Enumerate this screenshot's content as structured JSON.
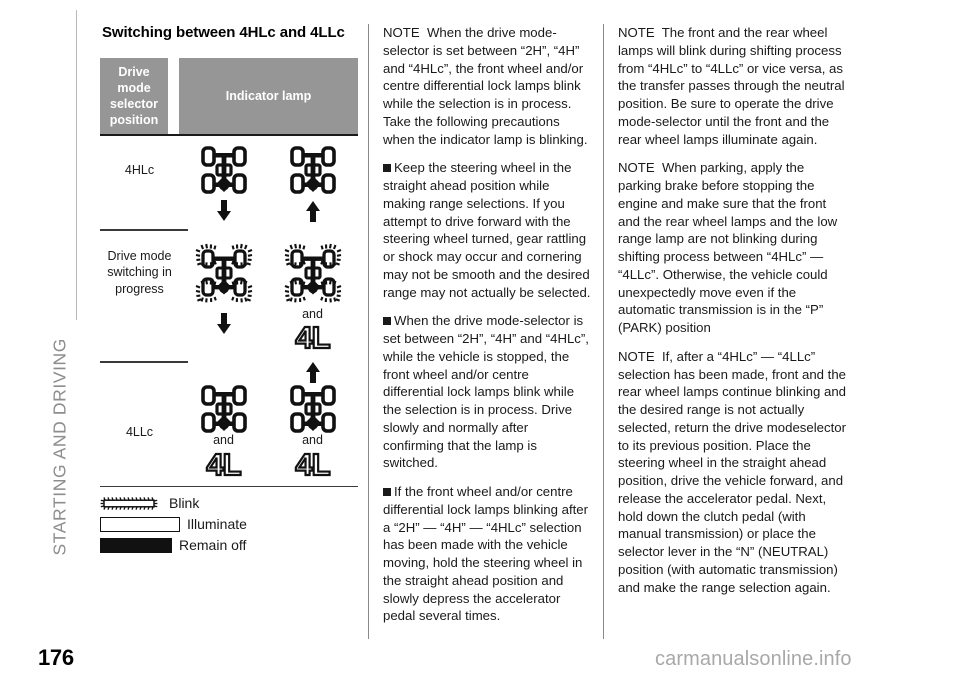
{
  "chapter": {
    "label": "STARTING AND DRIVING"
  },
  "page": {
    "number": "176"
  },
  "watermark": {
    "text": "carmanualsonline.info"
  },
  "section": {
    "title": "Switching between 4HLc and 4LLc"
  },
  "table": {
    "headers": {
      "col_selector": "Drive mode selector position",
      "col_indicator": "Indicator lamp"
    },
    "rows": [
      {
        "label": "4HLc",
        "left": {
          "icon": "four-wheel-drive-lamp",
          "state": "illuminate",
          "and": "",
          "badge": ""
        },
        "right": {
          "icon": "four-wheel-drive-lamp",
          "state": "illuminate",
          "and": "",
          "badge": ""
        },
        "left_arrow": "down",
        "right_arrow": "up"
      },
      {
        "label": "Drive mode switching in progress",
        "left": {
          "icon": "four-wheel-drive-lamp-blinking",
          "state": "blink",
          "and": "",
          "badge": ""
        },
        "right": {
          "icon": "four-wheel-drive-lamp-blinking",
          "state": "blink",
          "and": "and",
          "badge": "4L"
        },
        "left_arrow": "down",
        "right_arrow": "up"
      },
      {
        "label": "4LLc",
        "left": {
          "icon": "four-wheel-drive-lamp",
          "state": "illuminate",
          "and": "and",
          "badge": "4L"
        },
        "right": {
          "icon": "four-wheel-drive-lamp",
          "state": "illuminate",
          "and": "and",
          "badge": "4L"
        },
        "left_arrow": "",
        "right_arrow": ""
      }
    ]
  },
  "legend": {
    "items": [
      {
        "swatch": "blink-swatch",
        "label": "Blink"
      },
      {
        "swatch": "illuminate-swatch",
        "label": "Illuminate"
      },
      {
        "swatch": "remain-off-swatch",
        "label": "Remain off"
      }
    ]
  },
  "middle_column": {
    "note1_lead": "NOTE",
    "note1": "When the drive mode-selector is set between “2H”, “4H” and “4HLc”, the front wheel and/or centre differential lock lamps blink while the selection is in process. Take the following precautions when the indicator lamp is blinking.",
    "bullet1": "Keep the steering wheel in the straight ahead position while making range selections. If you attempt to drive forward with the steering wheel turned, gear rattling or shock may occur and cornering may not be smooth and the desired range may not actually be selected.",
    "bullet2": "When the drive mode-selector is set between “2H”, “4H” and “4HLc”, while the vehicle is stopped, the front wheel and/or centre differential lock lamps blink while the selection is in process. Drive slowly and normally after confirming that the lamp is switched.",
    "bullet3": "If the front wheel and/or centre differential lock lamps blinking after a “2H” — “4H” — “4HLc” selection has been made with the vehicle moving, hold the steering wheel in the straight ahead position and slowly depress the accelerator pedal several times."
  },
  "right_column": {
    "note2_lead": "NOTE",
    "note2": "The front and the rear wheel lamps will blink during shifting process from “4HLc” to “4LLc” or vice versa, as the transfer passes through the neutral position. Be sure to operate the drive mode-selector until the front and the rear wheel lamps illuminate again.",
    "note3_lead": "NOTE",
    "note3": "When parking, apply the parking brake before stopping the engine and make sure that the front and the rear wheel lamps and the low range lamp are not blinking during shifting process between “4HLc” — “4LLc”. Otherwise, the vehicle could unexpectedly move even if the automatic transmission is in the “P” (PARK) position",
    "note4_lead": "NOTE",
    "note4": "If, after a “4HLc” — “4LLc” selection has been made, front and the rear wheel lamps continue blinking and the desired range is not actually selected, return the drive modeselector to its previous position. Place the steering wheel in the straight ahead position, drive the vehicle forward, and release the accelerator pedal. Next, hold down the clutch pedal (with manual transmission) or place the selector lever in the “N” (NEUTRAL) position (with automatic transmission) and make the range selection again."
  },
  "colors": {
    "header_gray": "#969696",
    "rule_dark": "#3a3a3a",
    "tab_gray": "#8d8d8d",
    "watermark_gray": "#a8a8a8"
  }
}
